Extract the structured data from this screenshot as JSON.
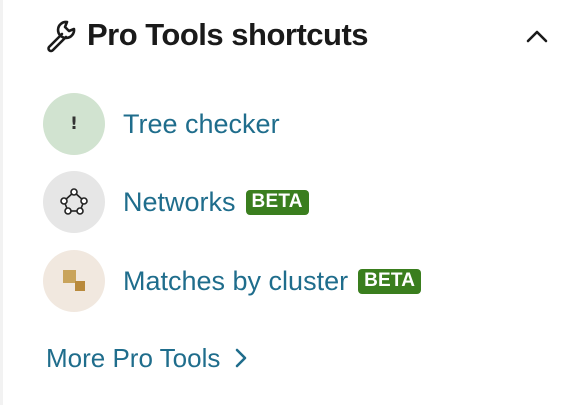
{
  "header": {
    "title": "Pro Tools shortcuts",
    "icon": "wrench-icon",
    "collapse_icon": "chevron-up-icon"
  },
  "items": [
    {
      "label": "Tree checker",
      "icon": "exclamation-icon",
      "badge": ""
    },
    {
      "label": "Networks",
      "icon": "network-icon",
      "badge": "BETA"
    },
    {
      "label": "Matches by cluster",
      "icon": "cluster-icon",
      "badge": "BETA"
    }
  ],
  "more": {
    "label": "More Pro Tools",
    "icon": "chevron-right-icon"
  },
  "colors": {
    "link": "#1f6d8c",
    "badge": "#3a7e1e",
    "tree_bg": "#d1e3d0",
    "network_bg": "#e6e6e6",
    "cluster_bg": "#f1e8df",
    "cluster_square": "#c9a45c"
  }
}
